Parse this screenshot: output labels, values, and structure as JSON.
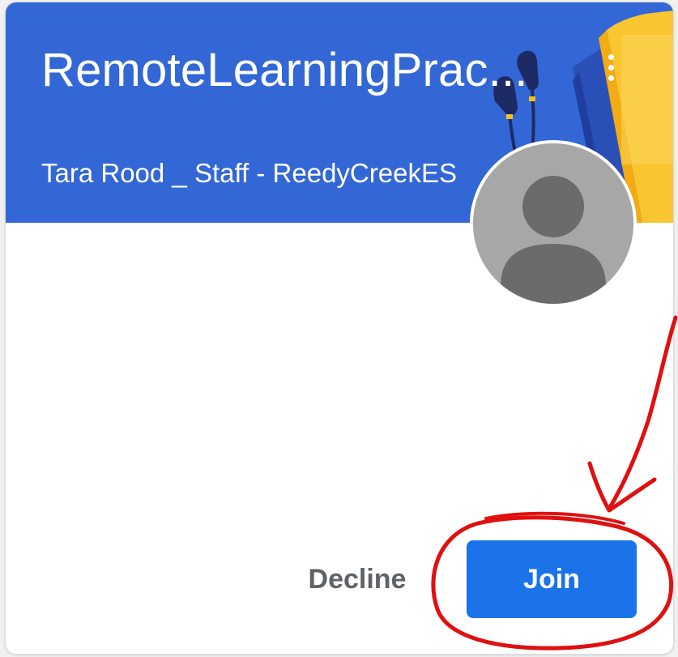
{
  "card": {
    "title": "RemoteLearningPrac...",
    "teacher": "Tara Rood _ Staff - ReedyCreekES",
    "menu_icon": "more-vert-icon",
    "avatar_icon": "default-person-avatar-icon",
    "header_color": "#3367d6"
  },
  "actions": {
    "decline_label": "Decline",
    "join_label": "Join",
    "join_color": "#1a73e8"
  },
  "annotation": {
    "type": "hand-drawn-arrow-and-circle",
    "color": "#e01010"
  }
}
